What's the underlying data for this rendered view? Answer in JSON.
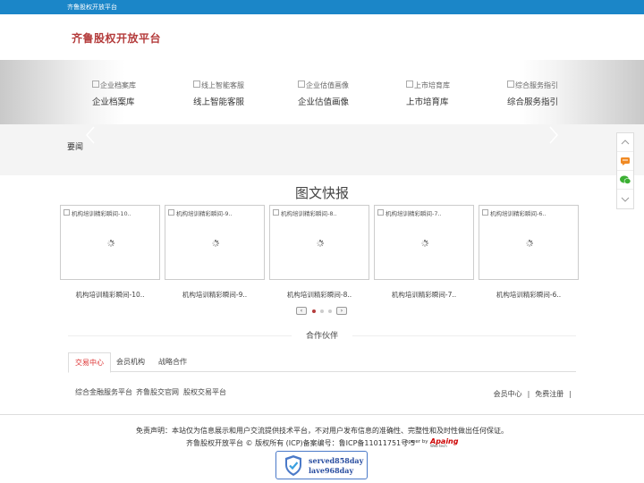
{
  "topbar": {
    "site_name": "齐鲁股权开放平台",
    "member_center": "会员中心",
    "register": "免费注册",
    "separator": "|"
  },
  "logo": {
    "text": "齐鲁股权开放平台"
  },
  "nav": [
    {
      "img_alt": "企业档案库",
      "label": "企业档案库"
    },
    {
      "img_alt": "线上智能客服",
      "label": "线上智能客服"
    },
    {
      "img_alt": "企业估值画像",
      "label": "企业估值画像"
    },
    {
      "img_alt": "上市培育库",
      "label": "上市培育库"
    },
    {
      "img_alt": "综合服务指引",
      "label": "综合服务指引"
    }
  ],
  "news": {
    "label": "要闻"
  },
  "sidebar": [
    {
      "icon": "chevron-up-icon",
      "color": "#999999"
    },
    {
      "icon": "chat-icon",
      "color": "#f08a24"
    },
    {
      "icon": "wechat-icon",
      "color": "#3cb034"
    },
    {
      "icon": "chevron-down-icon",
      "color": "#999999"
    }
  ],
  "section": {
    "title": "图文快报"
  },
  "cards": [
    {
      "img_alt": "机构培训精彩瞬间-10..",
      "caption": "机构培训精彩瞬间-10.."
    },
    {
      "img_alt": "机构培训精彩瞬间-9..",
      "caption": "机构培训精彩瞬间-9.."
    },
    {
      "img_alt": "机构培训精彩瞬间-8..",
      "caption": "机构培训精彩瞬间-8.."
    },
    {
      "img_alt": "机构培训精彩瞬间-7..",
      "caption": "机构培训精彩瞬间-7.."
    },
    {
      "img_alt": "机构培训精彩瞬间-6..",
      "caption": "机构培训精彩瞬间-6.."
    }
  ],
  "pager": {
    "prev": "‹",
    "next": "›",
    "active_dot": 0,
    "dot_count": 3,
    "active_color": "#b43c3c"
  },
  "partners": {
    "title": "合作伙伴",
    "tabs": [
      "交易中心",
      "会员机构",
      "战略合作"
    ],
    "active_tab": 0,
    "links": [
      "综合金融服务平台",
      "齐鲁股交官网",
      "股权交易平台"
    ]
  },
  "footer": {
    "disclaimer": "免责声明：本站仅为信息展示和用户交流提供技术平台，不对用户发布信息的准确性、完整性和及时性做出任何保证。",
    "copyright": "齐鲁股权开放平台 © 版权所有 (ICP)备案编号：鲁ICP备11011751号-5",
    "power_by": "power by",
    "brand": "Apaing",
    "brand_sub": "Web tech",
    "badge_line1": "served858day",
    "badge_line2": "lave968day"
  },
  "colors": {
    "topbar": "#1b86c8",
    "logo": "#b43c3c",
    "tab_active": "#dd3333",
    "badge_border": "#4a79c8"
  }
}
